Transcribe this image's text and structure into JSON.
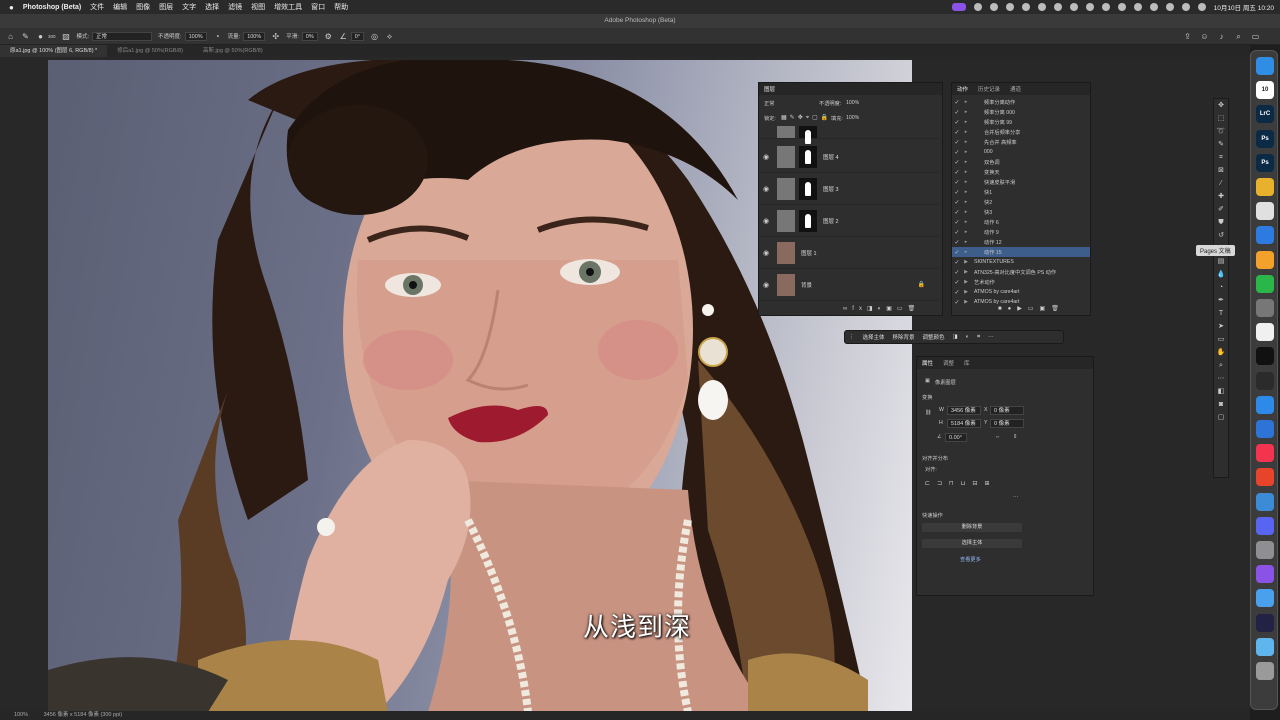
{
  "menubar": {
    "app": "Photoshop (Beta)",
    "menus": [
      "文件",
      "编辑",
      "图像",
      "图层",
      "文字",
      "选择",
      "滤镜",
      "视图",
      "增效工具",
      "窗口",
      "帮助"
    ],
    "clock": "10月10日 周五 10:20"
  },
  "window_title": "Adobe Photoshop (Beta)",
  "options": {
    "mode_label": "模式:",
    "mode_value": "正常",
    "opacity_label": "不透明度:",
    "opacity_value": "100%",
    "flow_label": "流量:",
    "flow_value": "100%",
    "smooth_label": "平滑:",
    "smooth_value": "0%",
    "angle_value": "0°",
    "brush_size": "300"
  },
  "tabs": [
    "原a1.jpg @ 100% (图层 6, RGB/8) *",
    "修后a1.jpg @ 50%(RGB/8)",
    "高斯.jpg @ 50%(RGB/8)"
  ],
  "status": {
    "zoom": "100%",
    "info": "3456 像素 x 5184 像素 (300 ppi)"
  },
  "subtitle": "从浅到深",
  "tooltip": "Pages 文稿",
  "layers_panel": {
    "tab": "图层",
    "blend": "正常",
    "opacity_label": "不透明度:",
    "opacity_value": "100%",
    "lock_label": "锁定:",
    "fill_label": "填充:",
    "fill_value": "100%",
    "layers": [
      {
        "name": "图层 4"
      },
      {
        "name": "图层 3"
      },
      {
        "name": "图层 2"
      },
      {
        "name": "图层 1"
      },
      {
        "name": "背景"
      }
    ]
  },
  "actions_panel": {
    "tabs": [
      "动作",
      "历史记录",
      "通道"
    ],
    "items": [
      "频率分离动作",
      "频率分离 000",
      "频率分离 99",
      "合并后频率分享",
      "先合并 高频率",
      "000",
      "双色调",
      "变换天",
      "快速皮肤平滑",
      "快1",
      "快2",
      "快3",
      "动作 6",
      "动作 9",
      "动作 12",
      "动作 15",
      "SKINTEXTURES",
      "ATN325-高对比度中文调色 PS 动作",
      "艺术动作",
      "ATMOS by care4art",
      "ATMOS by care4art"
    ]
  },
  "context_bar": {
    "select_subject": "选择主体",
    "remove_bg": "移除背景",
    "adjust_color": "调整颜色"
  },
  "properties_panel": {
    "tabs": [
      "属性",
      "调整",
      "库"
    ],
    "type": "像素图层",
    "transform_label": "变换",
    "w_label": "W",
    "w_value": "3456 像素",
    "h_label": "H",
    "h_value": "5184 像素",
    "x_label": "X",
    "x_value": "0 像素",
    "y_label": "Y",
    "y_value": "0 像素",
    "angle_value": "0.00°",
    "align_label": "对齐并分布",
    "align_sub": "对齐:",
    "quick_label": "快速操作",
    "remove_bg_btn": "删除背景",
    "select_subject_btn": "选择主体",
    "more_link": "查看更多"
  },
  "dock": {
    "apps": [
      {
        "name": "finder",
        "color": "#2f8de4",
        "label": ""
      },
      {
        "name": "calendar",
        "color": "#ffffff",
        "label": "10"
      },
      {
        "name": "lrc",
        "color": "#0b2a46",
        "label": "LrC"
      },
      {
        "name": "ps",
        "color": "#0b2a46",
        "label": "Ps"
      },
      {
        "name": "ps-beta",
        "color": "#0b2a46",
        "label": "Ps"
      },
      {
        "name": "app-yellow",
        "color": "#e8b12c",
        "label": ""
      },
      {
        "name": "chrome",
        "color": "#e0e0e0",
        "label": ""
      },
      {
        "name": "safari",
        "color": "#2d7be0",
        "label": ""
      },
      {
        "name": "pages",
        "color": "#f3a12a",
        "label": ""
      },
      {
        "name": "wechat",
        "color": "#2bb64a",
        "label": ""
      },
      {
        "name": "app-grey",
        "color": "#777777",
        "label": ""
      },
      {
        "name": "photos",
        "color": "#f0f0f0",
        "label": ""
      },
      {
        "name": "capcut",
        "color": "#111111",
        "label": ""
      },
      {
        "name": "finalcut",
        "color": "#2b2b2b",
        "label": ""
      },
      {
        "name": "app-blue",
        "color": "#2d8ae8",
        "label": ""
      },
      {
        "name": "keynote",
        "color": "#2e73d6",
        "label": ""
      },
      {
        "name": "music",
        "color": "#f4344f",
        "label": ""
      },
      {
        "name": "app-red",
        "color": "#e8432b",
        "label": ""
      },
      {
        "name": "edge",
        "color": "#3b8bd6",
        "label": ""
      },
      {
        "name": "discord",
        "color": "#5865f2",
        "label": ""
      },
      {
        "name": "settings",
        "color": "#8e8e93",
        "label": ""
      },
      {
        "name": "app-purple",
        "color": "#8a52e5",
        "label": ""
      },
      {
        "name": "app-lightblue",
        "color": "#4aa0ec",
        "label": ""
      },
      {
        "name": "app-dark",
        "color": "#222244",
        "label": ""
      },
      {
        "name": "folder",
        "color": "#5fb6ef",
        "label": ""
      },
      {
        "name": "trash",
        "color": "#9a9a9a",
        "label": ""
      }
    ]
  }
}
